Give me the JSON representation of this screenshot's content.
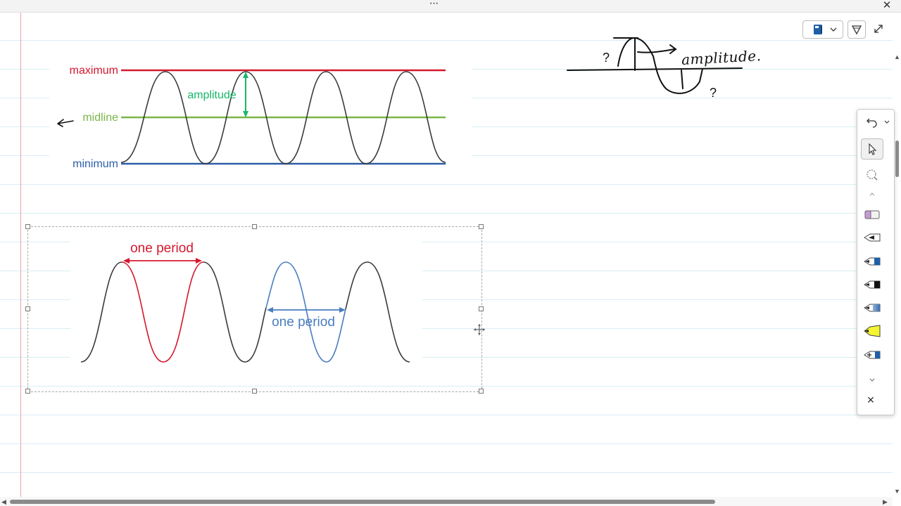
{
  "window": {
    "more_label": "···",
    "close_label": "✕"
  },
  "figure1": {
    "max_label": "maximum",
    "mid_label": "midline",
    "min_label": "minimum",
    "amplitude_label": "amplitude",
    "colors": {
      "max": "#d4182e",
      "mid": "#7ab648",
      "min": "#2e5ea8",
      "amp": "#16b86a",
      "curve": "#3b3b3b"
    }
  },
  "figure2": {
    "period_label_1": "one period",
    "period_label_2": "one period",
    "colors": {
      "red": "#d4182e",
      "blue": "#4a7dc0",
      "curve": "#3b3b3b"
    }
  },
  "ink": {
    "label": "amplitude.",
    "question_1": "?",
    "question_2": "?"
  },
  "toolbar": {
    "icons": [
      "notebook-icon",
      "chevron-down-icon",
      "ink-to-shape-icon",
      "expand-icon"
    ]
  },
  "pen_panel": {
    "tools": [
      "undo",
      "select",
      "lasso",
      "eraser",
      "pen-black",
      "pen-blue",
      "pen-dark",
      "pen-gradient",
      "highlighter-yellow",
      "pen-add"
    ],
    "close_label": "✕"
  }
}
